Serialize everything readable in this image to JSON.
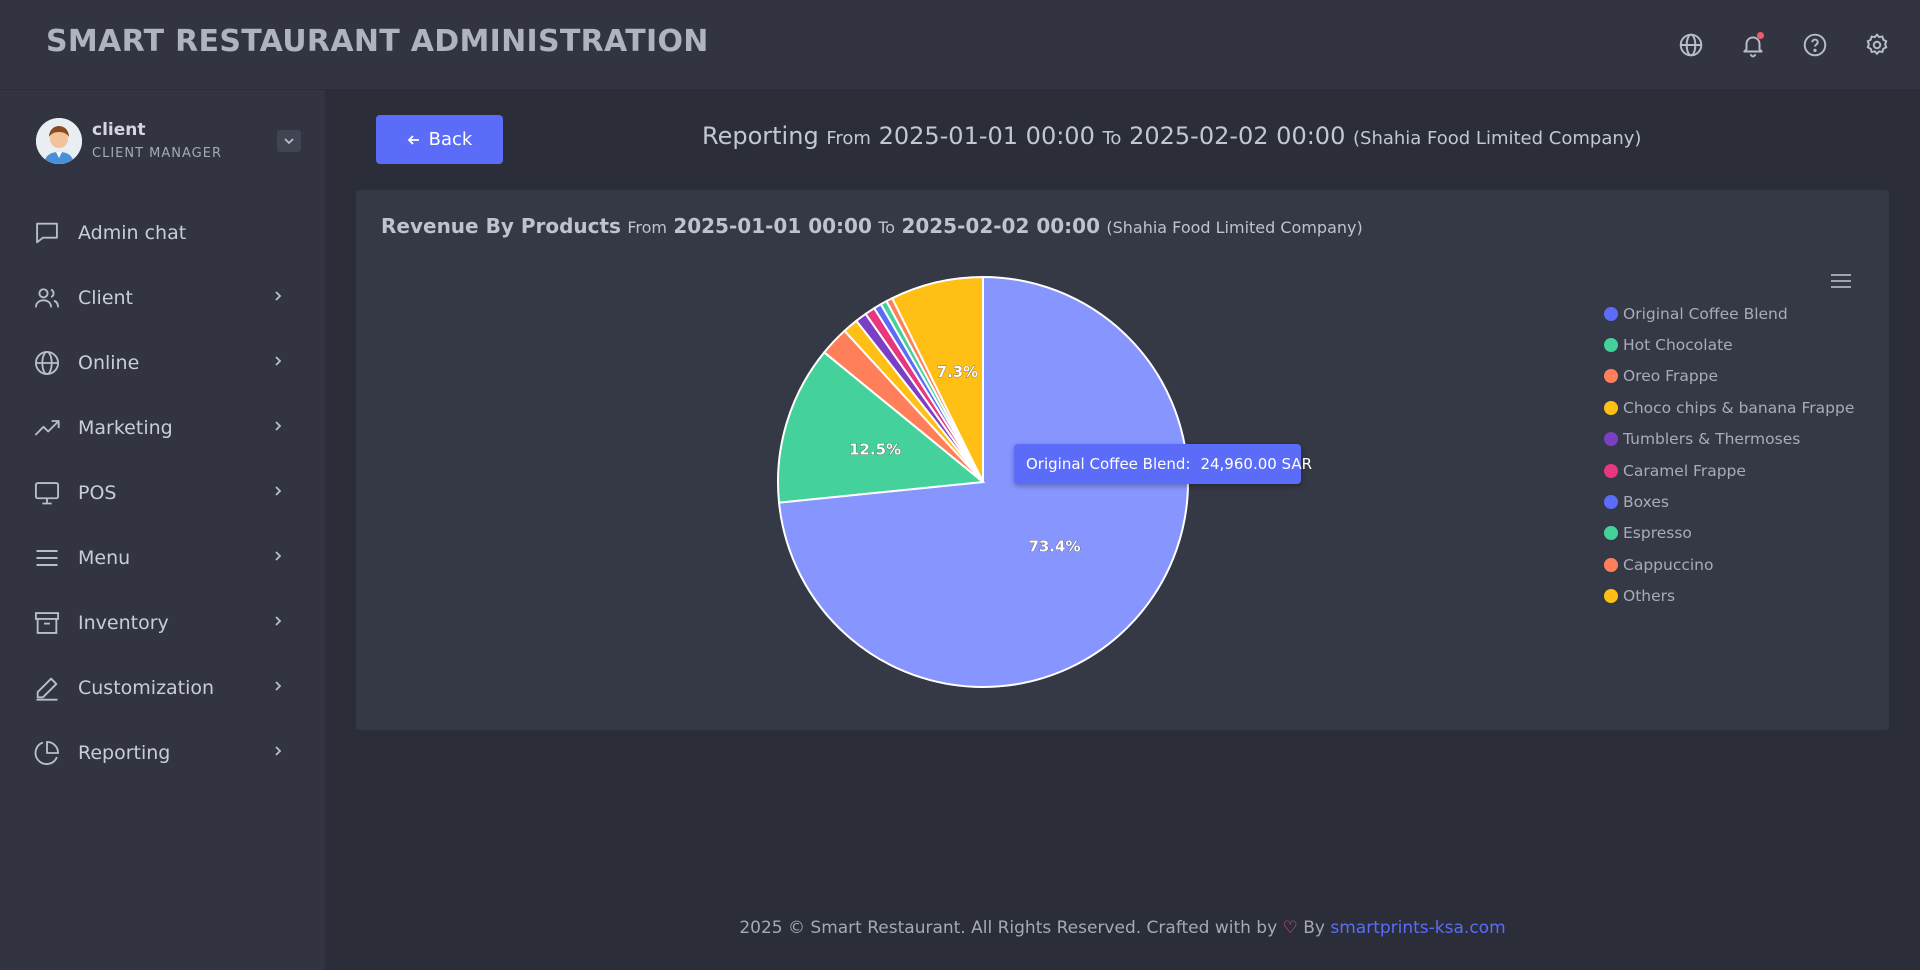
{
  "header": {
    "brand": "SMART RESTAURANT ADMINISTRATION",
    "icons": [
      "globe-icon",
      "bell-icon",
      "help-icon",
      "gear-icon"
    ]
  },
  "profile": {
    "name": "client",
    "role": "CLIENT MANAGER"
  },
  "sidebar": {
    "items": [
      {
        "label": "Admin chat",
        "icon": "chat-icon",
        "has_children": false
      },
      {
        "label": "Client",
        "icon": "users-icon",
        "has_children": true
      },
      {
        "label": "Online",
        "icon": "globe-icon",
        "has_children": true
      },
      {
        "label": "Marketing",
        "icon": "trending-up-icon",
        "has_children": true
      },
      {
        "label": "POS",
        "icon": "monitor-icon",
        "has_children": true
      },
      {
        "label": "Menu",
        "icon": "menu-icon",
        "has_children": true
      },
      {
        "label": "Inventory",
        "icon": "archive-icon",
        "has_children": true
      },
      {
        "label": "Customization",
        "icon": "pen-icon",
        "has_children": true
      },
      {
        "label": "Reporting",
        "icon": "pie-chart-icon",
        "has_children": true
      }
    ]
  },
  "back_button": {
    "label": "Back"
  },
  "report_header": {
    "title": "Reporting",
    "from_label": "From",
    "from": "2025-01-01 00:00",
    "to_label": "To",
    "to": "2025-02-02 00:00",
    "company": "(Shahia Food Limited Company)"
  },
  "card": {
    "title": "Revenue By Products",
    "from_label": "From",
    "from": "2025-01-01 00:00",
    "to_label": "To",
    "to": "2025-02-02 00:00",
    "company": "(Shahia Food Limited Company)"
  },
  "tooltip": {
    "label": "Original Coffee Blend:",
    "value": "24,960.00 SAR"
  },
  "chart_data": {
    "type": "pie",
    "categories": [
      "Original Coffee Blend",
      "Hot Chocolate",
      "Oreo Frappe",
      "Choco chips & banana Frappe",
      "Tumblers & Thermoses",
      "Caramel Frappe",
      "Boxes",
      "Espresso",
      "Cappuccino",
      "Others"
    ],
    "values": [
      73.4,
      12.5,
      2.3,
      1.2,
      0.9,
      0.8,
      0.6,
      0.5,
      0.5,
      7.3
    ],
    "colors": [
      "#8796ff",
      "#44d19b",
      "#ff7f5a",
      "#ffbf14",
      "#7b3fc4",
      "#e8377f",
      "#5b6cf9",
      "#44d19b",
      "#ff7f5a",
      "#ffbf14"
    ],
    "legend_colors": [
      "#5b6cf9",
      "#44d19b",
      "#ff7f5a",
      "#ffbf14",
      "#7b3fc4",
      "#e8377f",
      "#5b6cf9",
      "#44d19b",
      "#ff7f5a",
      "#ffbf14"
    ],
    "data_labels": [
      "73.4%",
      "12.5%",
      "",
      "",
      "",
      "",
      "",
      "",
      "",
      "7.3%"
    ],
    "highlighted": "Original Coffee Blend",
    "legend_position": "right"
  },
  "footer": {
    "text": "2025 © Smart Restaurant. All Rights Reserved. Crafted with by",
    "by": "By",
    "link": "smartprints-ksa.com"
  }
}
